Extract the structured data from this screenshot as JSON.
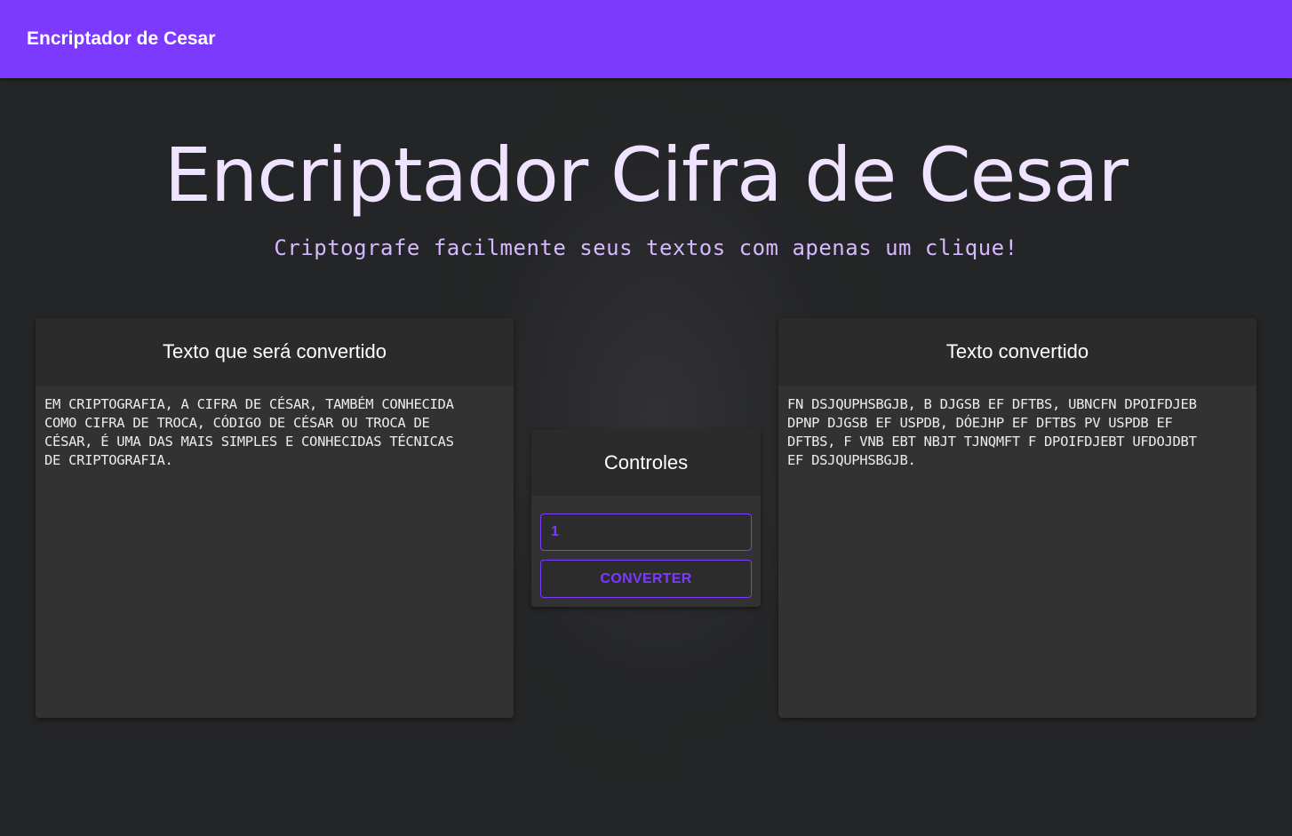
{
  "navbar": {
    "title": "Encriptador de Cesar"
  },
  "hero": {
    "title": "Encriptador Cifra de Cesar",
    "subtitle": "Criptografe facilmente seus textos com apenas um clique!"
  },
  "input_card": {
    "header": "Texto que será convertido",
    "text": "EM CRIPTOGRAFIA, A CIFRA DE CÉSAR, TAMBÉM CONHECIDA\nCOMO CIFRA DE TROCA, CÓDIGO DE CÉSAR OU TROCA DE\nCÉSAR, É UMA DAS MAIS SIMPLES E CONHECIDAS TÉCNICAS\nDE CRIPTOGRAFIA."
  },
  "controls_card": {
    "header": "Controles",
    "shift_value": "1",
    "convert_label": "CONVERTER"
  },
  "output_card": {
    "header": "Texto convertido",
    "text": "FN DSJQUPHSBGJB, B DJGSB EF DFTBS, UBNCFN DPOIFDJEB\nDPNP DJGSB EF USPDB, DÓEJHP EF DFTBS PV USPDB EF\nDFTBS, F VNB EBT NBJT TJNQMFT F DPOIFDJEBT UFDOJDBT\nEF DSJQUPHSBGJB."
  },
  "colors": {
    "accent": "#7c3aff",
    "background": "#242526",
    "card": "#323232",
    "hero_title": "#efe3ff",
    "hero_subtitle": "#d7b7ff"
  }
}
